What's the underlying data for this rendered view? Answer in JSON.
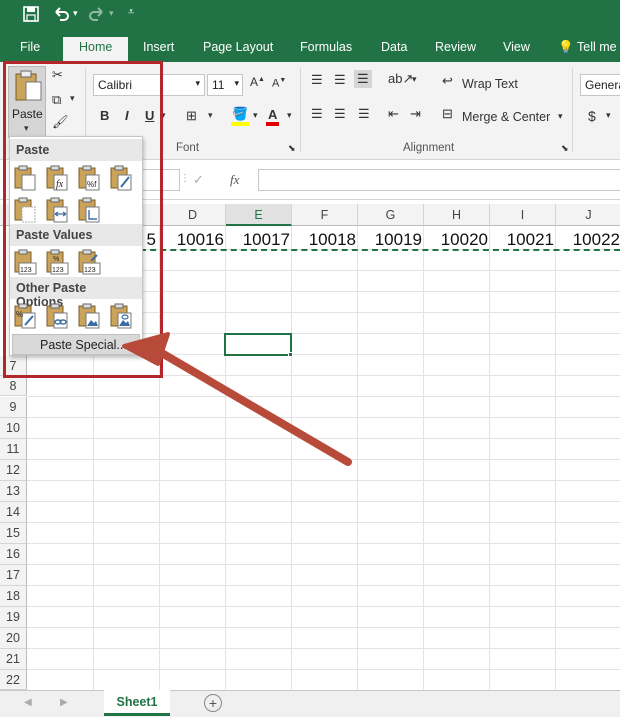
{
  "qat": {
    "save_icon": "save-icon",
    "undo_icon": "undo-icon",
    "redo_icon": "redo-icon",
    "customize_icon": "customize-qat-icon"
  },
  "tabs": [
    {
      "label": "File"
    },
    {
      "label": "Home"
    },
    {
      "label": "Insert"
    },
    {
      "label": "Page Layout"
    },
    {
      "label": "Formulas"
    },
    {
      "label": "Data"
    },
    {
      "label": "Review"
    },
    {
      "label": "View"
    },
    {
      "label": "Tell me"
    }
  ],
  "ribbon": {
    "paste_label": "Paste",
    "font_name": "Calibri",
    "font_size": "11",
    "bold": "B",
    "italic": "I",
    "underline": "U",
    "font_group": "Font",
    "alignment_group": "Alignment",
    "wrap_text": "Wrap Text",
    "merge_center": "Merge & Center",
    "number_format": "Genera",
    "currency": "$"
  },
  "formula_bar": {
    "fx": "fx"
  },
  "columns": [
    "D",
    "E",
    "F",
    "G",
    "H",
    "I",
    "J"
  ],
  "rows": [
    "7",
    "8",
    "9",
    "10",
    "11",
    "12",
    "13",
    "14",
    "15",
    "16",
    "17",
    "18",
    "19",
    "20",
    "21",
    "22"
  ],
  "row1_values": {
    "partial": "5",
    "cells": [
      "10016",
      "10017",
      "10018",
      "10019",
      "10020",
      "10021",
      "10022"
    ]
  },
  "paste_menu": {
    "section_paste": "Paste",
    "section_paste_values": "Paste Values",
    "section_other": "Other Paste Options",
    "paste_special": "Paste Special..."
  },
  "sheet_tab": "Sheet1",
  "colors": {
    "excel_green": "#217346",
    "highlight_red": "#b3262a",
    "arrow": "#b84a3a"
  }
}
